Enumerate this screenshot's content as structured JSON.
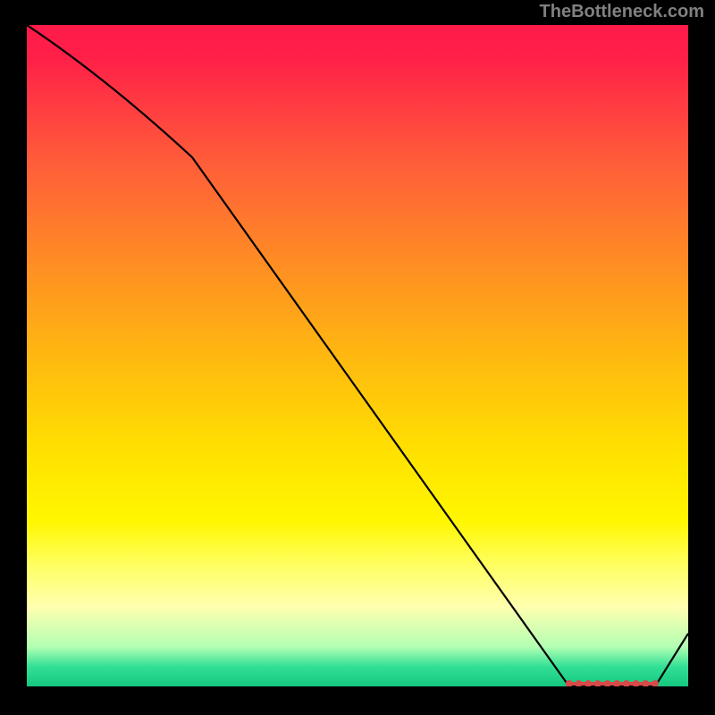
{
  "watermark": "TheBottleneck.com",
  "chart_data": {
    "type": "line",
    "title": "",
    "xlabel": "",
    "ylabel": "",
    "xlim": [
      0,
      100
    ],
    "ylim": [
      0,
      100
    ],
    "series": [
      {
        "name": "curve",
        "x": [
          0,
          25,
          82,
          95,
          100
        ],
        "y": [
          100,
          80,
          0,
          0,
          8
        ]
      }
    ],
    "markers": {
      "name": "bottleneck-range",
      "x_start": 82,
      "x_end": 95,
      "y": 0,
      "color": "#d84a4a"
    },
    "background": "vertical-gradient red→yellow→green"
  }
}
